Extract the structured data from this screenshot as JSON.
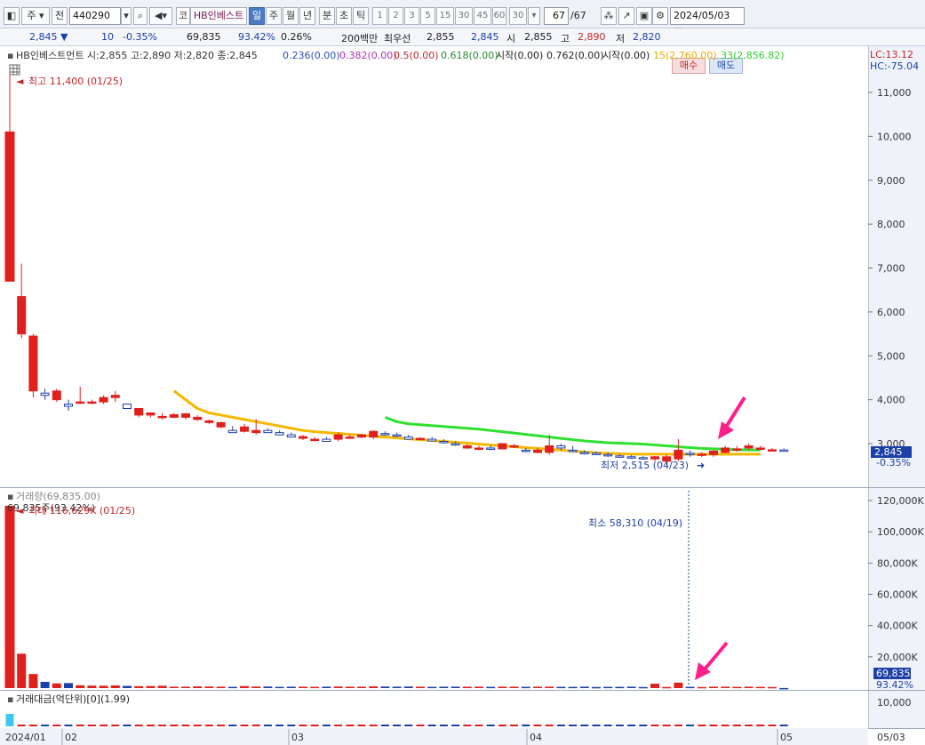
{
  "toolbar": {
    "period_select": "주",
    "prev_label": "전",
    "code": "440290",
    "search_icon": "search-icon",
    "market_tag": "코",
    "stock_name": "HB인베스트",
    "tabs": [
      "일",
      "주",
      "월",
      "년",
      "분",
      "초",
      "틱"
    ],
    "active_tab": "일",
    "interval_buttons": [
      "1",
      "2",
      "3",
      "5",
      "15",
      "30",
      "45",
      "60"
    ],
    "interval_value": "30",
    "page_count": "67",
    "page_total": "/67",
    "date": "2024/05/03"
  },
  "quote": {
    "price": "2,845",
    "direction": "▼",
    "change": "10",
    "change_pct": "-0.35%",
    "volume": "69,835",
    "volume_ratio": "93.42%",
    "turnover": "0.26%",
    "unit_label": "200백만",
    "best_label": "최우선",
    "best_ask": "2,855",
    "best_bid": "2,845",
    "open_label": "시",
    "open": "2,855",
    "high_label": "고",
    "high": "2,890",
    "low_label": "저",
    "low": "2,820",
    "buy_label": "매수",
    "sell_label": "매도"
  },
  "price_panel": {
    "header": "HB인베스트먼트 시:2,855 고:2,890 저:2,820 종:2,845",
    "indicators": [
      {
        "text": "0.236(0.00)",
        "color": "#2b4fb0"
      },
      {
        "text": "0.382(0.00)",
        "color": "#b030b0"
      },
      {
        "text": "0.5(0.00)",
        "color": "#c0282a"
      },
      {
        "text": "0.618(0.00)",
        "color": "#2a8a2a"
      },
      {
        "text": "시작(0.00)",
        "color": "#222222"
      },
      {
        "text": "0.762(0.00)",
        "color": "#222222"
      },
      {
        "text": "시작(0.00)",
        "color": "#222222"
      },
      {
        "text": "15(2,760.00)",
        "color": "#f0a800"
      },
      {
        "text": "33(2,856.82)",
        "color": "#2fd12f"
      }
    ],
    "lc": "LC:13.12",
    "hc": "HC:-75.04",
    "high_note": "최고 11,400 (01/25)",
    "low_note": "최저 2,515 (04/23)",
    "current_price_tag": "2,845",
    "current_change_tag": "-0.35%",
    "y_ticks": [
      "11,000",
      "10,000",
      "9,000",
      "8,000",
      "7,000",
      "6,000",
      "5,000",
      "4,000",
      "3,000"
    ]
  },
  "volume_panel": {
    "header": "거래량(69,835.00)",
    "sub_header": "69,835주(93.42%)",
    "max_note": "최대 116,629K (01/25)",
    "min_note": "최소 58,310 (04/19)",
    "current_tag": "69,835",
    "current_pct": "93.42%",
    "y_ticks": [
      "120,000K",
      "100,000K",
      "80,000K",
      "60,000K",
      "40,000K",
      "20,000K"
    ]
  },
  "amount_panel": {
    "header": "거래대금(억단위)[0](1.99)",
    "y_ticks": [
      "10,000"
    ]
  },
  "x_axis": {
    "labels": [
      "2024/01",
      "02",
      "03",
      "04",
      "05"
    ],
    "right_label": "05/03"
  },
  "colors": {
    "up": "#e0201c",
    "down": "#1c3fa8",
    "ma15": "#f5b800",
    "ma33": "#2fe02f",
    "arrow": "#ff1f8a"
  },
  "chart_data": {
    "type": "candlestick",
    "candles": [
      {
        "o": 6700,
        "h": 11400,
        "l": 6700,
        "c": 10100
      },
      {
        "o": 5500,
        "h": 7100,
        "l": 5400,
        "c": 6350
      },
      {
        "o": 4200,
        "h": 5500,
        "l": 4050,
        "c": 5450
      },
      {
        "o": 4150,
        "h": 4250,
        "l": 4000,
        "c": 4100
      },
      {
        "o": 4000,
        "h": 4250,
        "l": 3950,
        "c": 4200
      },
      {
        "o": 3900,
        "h": 4000,
        "l": 3750,
        "c": 3850
      },
      {
        "o": 3950,
        "h": 4300,
        "l": 3900,
        "c": 3950
      },
      {
        "o": 3950,
        "h": 4000,
        "l": 3900,
        "c": 3950
      },
      {
        "o": 3950,
        "h": 4100,
        "l": 3900,
        "c": 4050
      },
      {
        "o": 4050,
        "h": 4200,
        "l": 3950,
        "c": 4100
      },
      {
        "o": 3900,
        "h": 3900,
        "l": 3800,
        "c": 3800
      },
      {
        "o": 3650,
        "h": 3800,
        "l": 3600,
        "c": 3800
      },
      {
        "o": 3650,
        "h": 3700,
        "l": 3600,
        "c": 3700
      },
      {
        "o": 3600,
        "h": 3700,
        "l": 3550,
        "c": 3620
      },
      {
        "o": 3600,
        "h": 3700,
        "l": 3580,
        "c": 3660
      },
      {
        "o": 3600,
        "h": 3700,
        "l": 3550,
        "c": 3680
      },
      {
        "o": 3550,
        "h": 3650,
        "l": 3520,
        "c": 3600
      },
      {
        "o": 3480,
        "h": 3550,
        "l": 3450,
        "c": 3520
      },
      {
        "o": 3380,
        "h": 3500,
        "l": 3350,
        "c": 3480
      },
      {
        "o": 3300,
        "h": 3400,
        "l": 3250,
        "c": 3250
      },
      {
        "o": 3280,
        "h": 3450,
        "l": 3250,
        "c": 3380
      },
      {
        "o": 3250,
        "h": 3560,
        "l": 3200,
        "c": 3300
      },
      {
        "o": 3300,
        "h": 3350,
        "l": 3250,
        "c": 3250
      },
      {
        "o": 3250,
        "h": 3300,
        "l": 3200,
        "c": 3200
      },
      {
        "o": 3200,
        "h": 3250,
        "l": 3150,
        "c": 3150
      },
      {
        "o": 3120,
        "h": 3200,
        "l": 3080,
        "c": 3160
      },
      {
        "o": 3100,
        "h": 3150,
        "l": 3050,
        "c": 3100
      },
      {
        "o": 3100,
        "h": 3150,
        "l": 3050,
        "c": 3050
      },
      {
        "o": 3100,
        "h": 3250,
        "l": 3050,
        "c": 3200
      },
      {
        "o": 3150,
        "h": 3200,
        "l": 3120,
        "c": 3150
      },
      {
        "o": 3150,
        "h": 3220,
        "l": 3120,
        "c": 3200
      },
      {
        "o": 3150,
        "h": 3300,
        "l": 3100,
        "c": 3280
      },
      {
        "o": 3230,
        "h": 3280,
        "l": 3180,
        "c": 3200
      },
      {
        "o": 3200,
        "h": 3250,
        "l": 3150,
        "c": 3170
      },
      {
        "o": 3150,
        "h": 3200,
        "l": 3100,
        "c": 3100
      },
      {
        "o": 3100,
        "h": 3150,
        "l": 3080,
        "c": 3120
      },
      {
        "o": 3100,
        "h": 3150,
        "l": 3050,
        "c": 3060
      },
      {
        "o": 3050,
        "h": 3100,
        "l": 3000,
        "c": 3020
      },
      {
        "o": 3000,
        "h": 3050,
        "l": 2950,
        "c": 2970
      },
      {
        "o": 2900,
        "h": 2980,
        "l": 2880,
        "c": 2950
      },
      {
        "o": 2880,
        "h": 2950,
        "l": 2850,
        "c": 2900
      },
      {
        "o": 2900,
        "h": 2950,
        "l": 2850,
        "c": 2880
      },
      {
        "o": 2880,
        "h": 3000,
        "l": 2870,
        "c": 3000
      },
      {
        "o": 2950,
        "h": 3000,
        "l": 2900,
        "c": 2950
      },
      {
        "o": 2850,
        "h": 2900,
        "l": 2800,
        "c": 2830
      },
      {
        "o": 2800,
        "h": 2900,
        "l": 2780,
        "c": 2850
      },
      {
        "o": 2800,
        "h": 3200,
        "l": 2750,
        "c": 2950
      },
      {
        "o": 2950,
        "h": 3000,
        "l": 2850,
        "c": 2900
      },
      {
        "o": 2850,
        "h": 2950,
        "l": 2800,
        "c": 2820
      },
      {
        "o": 2800,
        "h": 2850,
        "l": 2750,
        "c": 2780
      },
      {
        "o": 2780,
        "h": 2820,
        "l": 2740,
        "c": 2760
      },
      {
        "o": 2750,
        "h": 2800,
        "l": 2700,
        "c": 2720
      },
      {
        "o": 2720,
        "h": 2760,
        "l": 2680,
        "c": 2700
      },
      {
        "o": 2700,
        "h": 2740,
        "l": 2650,
        "c": 2680
      },
      {
        "o": 2680,
        "h": 2720,
        "l": 2640,
        "c": 2660
      },
      {
        "o": 2650,
        "h": 2720,
        "l": 2600,
        "c": 2700
      },
      {
        "o": 2600,
        "h": 2750,
        "l": 2515,
        "c": 2700
      },
      {
        "o": 2650,
        "h": 3100,
        "l": 2600,
        "c": 2850
      },
      {
        "o": 2780,
        "h": 2850,
        "l": 2700,
        "c": 2750
      },
      {
        "o": 2750,
        "h": 2800,
        "l": 2700,
        "c": 2760
      },
      {
        "o": 2750,
        "h": 2850,
        "l": 2700,
        "c": 2830
      },
      {
        "o": 2800,
        "h": 2950,
        "l": 2780,
        "c": 2900
      },
      {
        "o": 2850,
        "h": 2950,
        "l": 2820,
        "c": 2880
      },
      {
        "o": 2900,
        "h": 3000,
        "l": 2850,
        "c": 2950
      },
      {
        "o": 2880,
        "h": 2950,
        "l": 2850,
        "c": 2900
      },
      {
        "o": 2860,
        "h": 2900,
        "l": 2820,
        "c": 2860
      },
      {
        "o": 2855,
        "h": 2890,
        "l": 2820,
        "c": 2845
      }
    ],
    "ma15": [
      4200,
      4000,
      3800,
      3700,
      3650,
      3600,
      3550,
      3500,
      3450,
      3400,
      3350,
      3300,
      3270,
      3250,
      3230,
      3210,
      3190,
      3170,
      3150,
      3130,
      3110,
      3090,
      3070,
      3050,
      3030,
      3010,
      2990,
      2970,
      2950,
      2930,
      2910,
      2890,
      2870,
      2850,
      2830,
      2810,
      2790,
      2780,
      2770,
      2760,
      2760,
      2760,
      2760,
      2760,
      2760,
      2760,
      2760,
      2760,
      2760,
      2760,
      2760
    ],
    "ma33": [
      3600,
      3500,
      3450,
      3430,
      3410,
      3390,
      3370,
      3350,
      3330,
      3300,
      3270,
      3240,
      3210,
      3180,
      3150,
      3120,
      3090,
      3060,
      3040,
      3020,
      3010,
      3000,
      2990,
      2970,
      2950,
      2930,
      2910,
      2890,
      2880,
      2870,
      2860,
      2856.82,
      2856.82
    ],
    "volume_k": [
      116629,
      22000,
      9000,
      4000,
      3000,
      3200,
      1800,
      1600,
      1500,
      1700,
      1400,
      1200,
      1300,
      1500,
      900,
      900,
      1100,
      1000,
      900,
      800,
      1300,
      1000,
      1000,
      800,
      900,
      900,
      800,
      900,
      1000,
      900,
      900,
      1100,
      1000,
      900,
      1000,
      900,
      800,
      900,
      900,
      900,
      900,
      800,
      900,
      900,
      800,
      900,
      900,
      800,
      800,
      900,
      700,
      800,
      800,
      900,
      700,
      2800,
      700,
      3500,
      800,
      700,
      900,
      900,
      800,
      900,
      800,
      700,
      69.835
    ]
  }
}
